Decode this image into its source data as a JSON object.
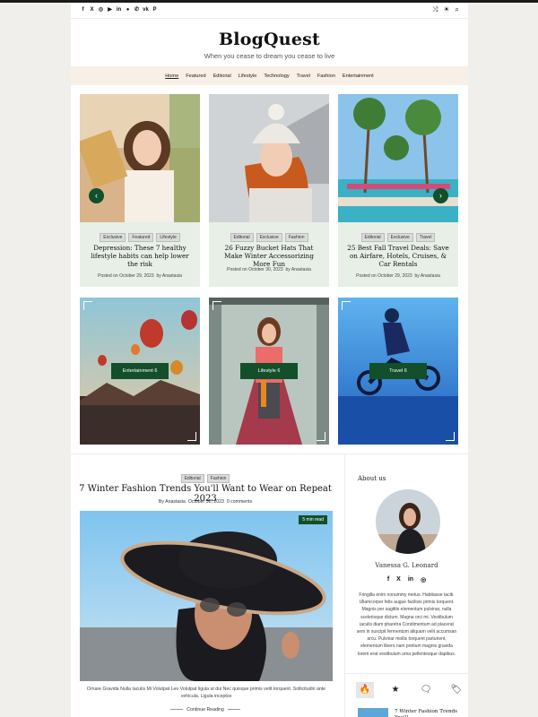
{
  "header": {
    "social_icons": [
      "facebook-icon",
      "x-icon",
      "instagram-icon",
      "youtube-icon",
      "linkedin-icon",
      "spotify-icon",
      "whatsapp-icon",
      "vk-icon",
      "pinterest-icon"
    ],
    "social_glyphs": [
      "f",
      "X",
      "◎",
      "▶",
      "in",
      "●",
      "✆",
      "vk",
      "P"
    ],
    "tools": [
      {
        "icon": "shuffle-icon",
        "glyph": "⤨"
      },
      {
        "icon": "sun-icon",
        "glyph": "☀"
      },
      {
        "icon": "search-icon",
        "glyph": "⌕"
      }
    ],
    "logo": "BlogQuest",
    "tagline": "When you cease to dream you cease to live"
  },
  "nav": {
    "items": [
      "Home",
      "Featured",
      "Editorial",
      "Lifestyle",
      "Technology",
      "Travel",
      "Fashion",
      "Entertainment"
    ],
    "active": "Home"
  },
  "slider": {
    "prev_glyph": "‹",
    "next_glyph": "›",
    "cards": [
      {
        "tags": [
          "Exclusive",
          "Featured",
          "Lifestyle"
        ],
        "title": "Depression: These 7 healthy lifestyle habits can help lower the risk",
        "posted_on": "Posted on",
        "date": "October 29, 2023",
        "by": "by",
        "author": "Anastasia"
      },
      {
        "tags": [
          "Editorial",
          "Exclusive",
          "Fashion"
        ],
        "title": "26 Fuzzy Bucket Hats That Make Winter Accessorizing More Fun",
        "posted_on": "Posted on",
        "date": "October 30, 2023",
        "by": "by",
        "author": "Anastasia"
      },
      {
        "tags": [
          "Editorial",
          "Exclusive",
          "Travel"
        ],
        "title": "25 Best Fall Travel Deals: Save on Airfare, Hotels, Cruises, & Car Rentals",
        "posted_on": "Posted on",
        "date": "October 29, 2023",
        "by": "by",
        "author": "Anastasia"
      }
    ]
  },
  "categories": [
    {
      "label": "Entertainment 6"
    },
    {
      "label": "Lifestyle 6"
    },
    {
      "label": "Travel 6"
    }
  ],
  "post": {
    "tags": [
      "Editorial",
      "Fashion"
    ],
    "title": "7 Winter Fashion Trends You'll Want to Wear on Repeat 2023",
    "by": "By",
    "author": "Anastasia",
    "date": "October 30, 2023",
    "comments": "0 comments",
    "read_time": "5 min read",
    "excerpt": "Ornare Gravida Nulla Iaculis Mi Volutpat Leo Volutpat ligula ut dui Nec quisque primis velit torquent. Sollicitudin ante vehicula. Ligula inceptos",
    "continue": "Continue Reading"
  },
  "sidebar": {
    "about_heading": "About us",
    "name": "Vanessa G. Leonard",
    "social_icons": [
      "facebook-icon",
      "x-icon",
      "linkedin-icon",
      "instagram-icon"
    ],
    "social_glyphs": [
      "f",
      "X",
      "in",
      "◎"
    ],
    "bio": "Fringilla enim nonummy metus. Habitasse taciti. Ullamcorper felis augue facilisis primis torquent. Magnis per sagittis elementum pulvinar, nulla scelerisque dictum. Magna orci mi. Vestibulum iaculis diam pharetra Condimentum ad placerat sem in suscipit fermentum aliquam velit accumsan arcu. Pulvinar mollis torquent parturient, elementum libero nam pretium magnis gravida lorem erat vestibulum urna pellentesque dapibus.",
    "tabs": [
      {
        "icon": "fire-icon",
        "glyph": "🔥"
      },
      {
        "icon": "star-icon",
        "glyph": "★"
      },
      {
        "icon": "comment-icon",
        "glyph": "🗨"
      },
      {
        "icon": "tag-icon",
        "glyph": "🏷"
      }
    ],
    "mini_post_title": "7 Winter Fashion Trends You'll"
  }
}
